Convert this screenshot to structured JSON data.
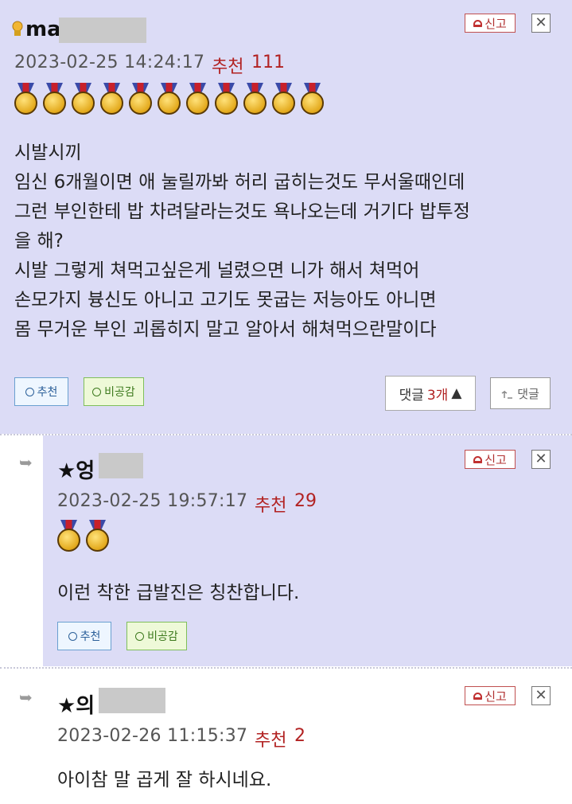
{
  "comments": [
    {
      "author_prefix": "ma",
      "date": "2023-02-25 14:24:17",
      "recommend_label": "추천",
      "recommend_count": "111",
      "medal_count": 11,
      "lines": [
        "시발시끼",
        "임신 6개월이면 애 눌릴까봐 허리 굽히는것도 무서울때인데",
        "그런 부인한테 밥 차려달라는것도 욕나오는데 거기다 밥투정",
        "을 해?",
        "시발 그렇게 쳐먹고싶은게 널렸으면 니가 해서 쳐먹어",
        "손모가지 븅신도 아니고 고기도 못굽는 저능아도 아니면",
        "몸 무거운 부인 괴롭히지 말고 알아서 해쳐먹으란말이다"
      ]
    },
    {
      "author_prefix": "★엉",
      "date": "2023-02-25 19:57:17",
      "recommend_label": "추천",
      "recommend_count": "29",
      "medal_count": 2,
      "lines": [
        "이런 착한 급발진은 칭찬합니다."
      ]
    },
    {
      "author_prefix": "★의",
      "date": "2023-02-26 11:15:37",
      "recommend_label": "추천",
      "recommend_count": "2",
      "lines": [
        "아이참 말 곱게 잘 하시네요."
      ]
    }
  ],
  "buttons": {
    "report": "신고",
    "close": "✕",
    "recommend": "추천",
    "unlike": "비공감",
    "replies_label": "댓글",
    "replies_count": "3개",
    "replies_arrow": "▲",
    "write_reply": "댓글"
  },
  "colors": {
    "comment_bg": "#dcdcf6",
    "recommend_red": "#b22222",
    "star_orange": "#f08a00"
  }
}
